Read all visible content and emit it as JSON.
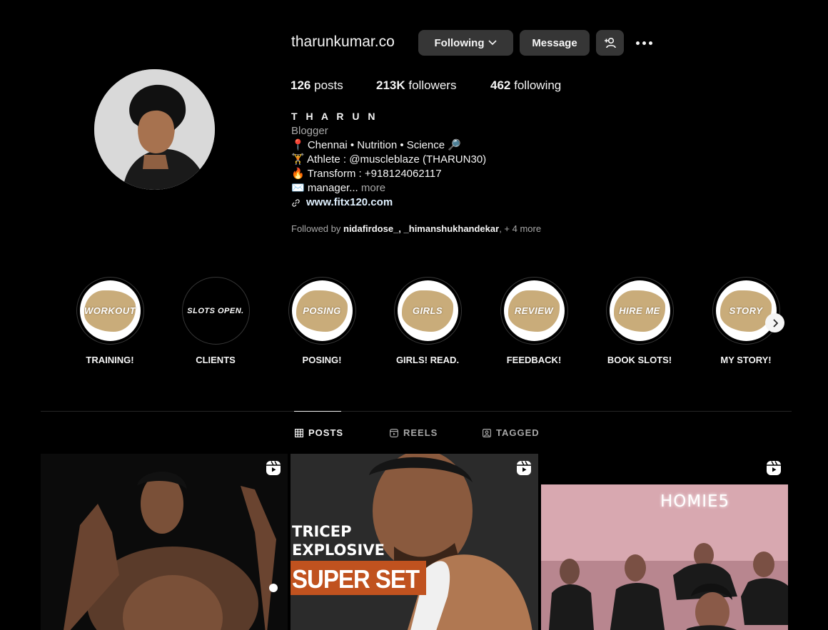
{
  "profile": {
    "username": "tharunkumar.co",
    "following_label": "Following",
    "message_label": "Message",
    "stats": {
      "posts_count": "126",
      "posts_label": "posts",
      "followers_count": "213K",
      "followers_label": "followers",
      "following_count": "462",
      "following_label": "following"
    },
    "full_name": "T H A R U N",
    "category": "Blogger",
    "bio_lines": [
      "📍 Chennai • Nutrition • Science 🔎",
      "🏋 Athlete : @muscleblaze (THARUN30)",
      "🔥 Transform : +918124062117",
      "✉️ manager..."
    ],
    "bio_more": "more",
    "website": "www.fitx120.com",
    "followed_by_prefix": "Followed by",
    "followed_by_users": "nidafirdose_, _himanshukhandekar",
    "followed_by_suffix": ", + 4 more"
  },
  "highlights": [
    {
      "cover_text": "WORKOUT",
      "label": "TRAINING!"
    },
    {
      "cover_text": "SLOTS OPEN.",
      "label": "CLIENTS"
    },
    {
      "cover_text": "POSING",
      "label": "POSING!"
    },
    {
      "cover_text": "GIRLS",
      "label": "GIRLS! READ."
    },
    {
      "cover_text": "REVIEW",
      "label": "FEEDBACK!"
    },
    {
      "cover_text": "HIRE ME",
      "label": "BOOK SLOTS!"
    },
    {
      "cover_text": "STORY",
      "label": "MY STORY!"
    }
  ],
  "tabs": [
    {
      "label": "POSTS",
      "icon": "grid-icon",
      "active": true
    },
    {
      "label": "REELS",
      "icon": "reels-icon",
      "active": false
    },
    {
      "label": "TAGGED",
      "icon": "tagged-icon",
      "active": false
    }
  ],
  "posts": [
    {
      "type": "reel",
      "overlay_text": []
    },
    {
      "type": "reel",
      "overlay_text": [
        "TRICEP",
        "EXPLOSIVE",
        "SUPER SET"
      ]
    },
    {
      "type": "reel",
      "overlay_text": [
        "HOMIE5"
      ]
    }
  ],
  "colors": {
    "background": "#000000",
    "button": "#363636",
    "secondary_text": "#a8a8a8",
    "highlight_splash": "#c9ac7a",
    "superset_banner": "#c0521f"
  }
}
